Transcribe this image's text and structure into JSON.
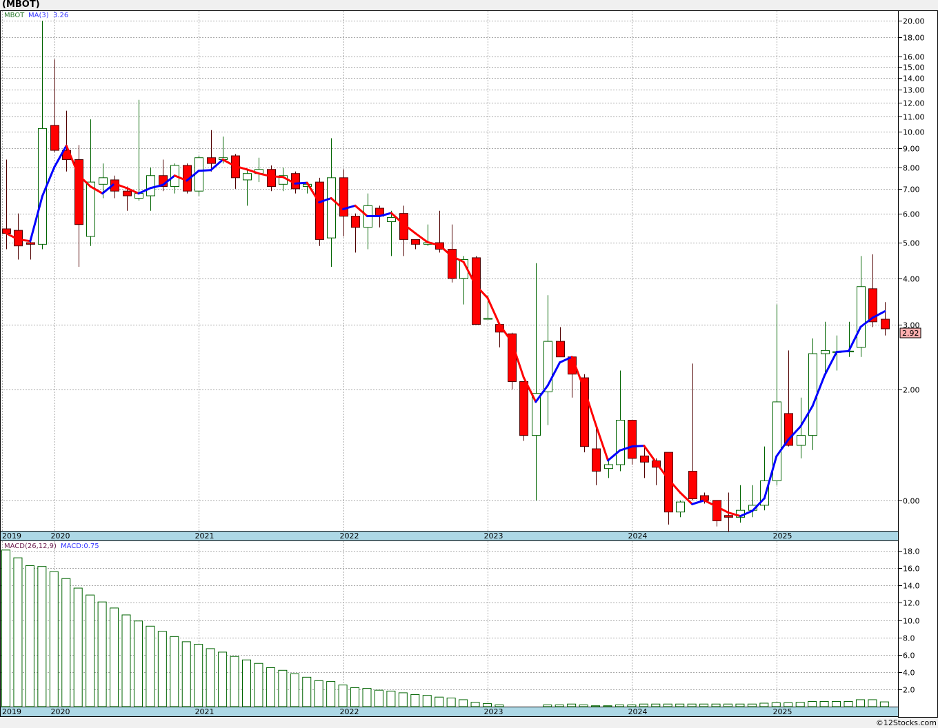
{
  "header": {
    "title": "(MBOT)",
    "copyright": "©12Stocks.com"
  },
  "legend": {
    "symbol": "MBOT",
    "ma_label": "MA(3)",
    "ma_value": "3.26",
    "macd_label": "MACD(26,12,9)",
    "macd_value": "MACD:0.75"
  },
  "colors": {
    "up": "#008000",
    "down": "#ff0000",
    "ma_up": "#0000ff",
    "ma_down": "#ff0000",
    "macd_bar": "#006400",
    "date_band": "#add8e6",
    "last_price_bg": "#ffb0b0"
  },
  "chart_data": [
    {
      "type": "candlestick",
      "interval": "monthly",
      "y_scale": "log",
      "ylim": [
        0.83,
        21
      ],
      "grid": true,
      "last_price": "2.92",
      "y_ticks": [
        {
          "v": 20,
          "label": "20.00"
        },
        {
          "v": 18,
          "label": "18.00"
        },
        {
          "v": 16,
          "label": "16.00"
        },
        {
          "v": 15,
          "label": "15.00"
        },
        {
          "v": 14,
          "label": "14.00"
        },
        {
          "v": 13,
          "label": "13.00"
        },
        {
          "v": 12,
          "label": "12.00"
        },
        {
          "v": 11,
          "label": "11.00"
        },
        {
          "v": 10,
          "label": "10.00"
        },
        {
          "v": 9,
          "label": "9.00"
        },
        {
          "v": 8,
          "label": "8.00"
        },
        {
          "v": 7,
          "label": "7.00"
        },
        {
          "v": 6,
          "label": "6.00"
        },
        {
          "v": 5,
          "label": "5.00"
        },
        {
          "v": 4,
          "label": "4.00"
        },
        {
          "v": 3,
          "label": "3.00"
        },
        {
          "v": 2,
          "label": "2.00"
        },
        {
          "v": 1,
          "label": "0.00"
        }
      ],
      "x_ticks": [
        {
          "index": -0.35,
          "label": "2019"
        },
        {
          "index": 4,
          "label": "2020"
        },
        {
          "index": 16,
          "label": "2021"
        },
        {
          "index": 28,
          "label": "2022"
        },
        {
          "index": 40,
          "label": "2023"
        },
        {
          "index": 52,
          "label": "2024"
        },
        {
          "index": 64,
          "label": "2025"
        }
      ],
      "first_month": "2019-09",
      "ohlc": [
        [
          5.45,
          8.4,
          4.8,
          5.3
        ],
        [
          5.4,
          6.0,
          4.5,
          4.9
        ],
        [
          5.0,
          5.1,
          4.5,
          4.95
        ],
        [
          4.95,
          20.0,
          4.8,
          10.2
        ],
        [
          10.4,
          15.7,
          8.8,
          8.9
        ],
        [
          8.9,
          11.4,
          7.8,
          8.4
        ],
        [
          8.4,
          9.2,
          4.3,
          5.6
        ],
        [
          5.2,
          10.8,
          4.9,
          7.3
        ],
        [
          7.2,
          8.2,
          6.6,
          7.5
        ],
        [
          7.4,
          7.6,
          6.6,
          6.9
        ],
        [
          6.9,
          7.1,
          6.1,
          6.7
        ],
        [
          6.6,
          12.2,
          6.5,
          6.8
        ],
        [
          6.7,
          8.0,
          6.1,
          7.6
        ],
        [
          7.6,
          8.4,
          6.9,
          7.1
        ],
        [
          7.1,
          8.2,
          6.8,
          8.1
        ],
        [
          8.1,
          8.2,
          6.8,
          6.9
        ],
        [
          6.9,
          8.6,
          6.7,
          8.5
        ],
        [
          8.5,
          10.1,
          7.8,
          8.2
        ],
        [
          8.4,
          9.7,
          8.2,
          8.5
        ],
        [
          8.6,
          8.7,
          7.0,
          7.5
        ],
        [
          7.4,
          7.9,
          6.3,
          7.7
        ],
        [
          7.7,
          8.5,
          7.3,
          7.9
        ],
        [
          7.9,
          8.1,
          6.9,
          7.1
        ],
        [
          7.2,
          8.0,
          6.9,
          7.6
        ],
        [
          7.7,
          7.8,
          6.8,
          7.0
        ],
        [
          7.1,
          7.3,
          6.8,
          7.2
        ],
        [
          7.3,
          7.5,
          4.9,
          5.1
        ],
        [
          5.15,
          9.6,
          4.3,
          7.5
        ],
        [
          7.5,
          7.9,
          5.2,
          5.9
        ],
        [
          5.9,
          6.0,
          4.7,
          5.5
        ],
        [
          5.5,
          6.8,
          4.8,
          6.3
        ],
        [
          6.2,
          6.3,
          5.5,
          5.9
        ],
        [
          5.7,
          6.1,
          4.6,
          5.85
        ],
        [
          6.0,
          6.3,
          4.6,
          5.1
        ],
        [
          5.1,
          5.1,
          4.8,
          4.95
        ],
        [
          4.95,
          5.6,
          4.9,
          5.0
        ],
        [
          5.0,
          6.1,
          4.7,
          4.8
        ],
        [
          4.8,
          5.6,
          3.9,
          4.0
        ],
        [
          4.0,
          4.6,
          3.4,
          4.5
        ],
        [
          4.55,
          4.6,
          3.0,
          3.0
        ],
        [
          3.1,
          3.6,
          3.1,
          3.12
        ],
        [
          3.0,
          3.0,
          2.6,
          2.86
        ],
        [
          2.83,
          2.85,
          2.0,
          2.1
        ],
        [
          2.1,
          2.1,
          1.45,
          1.5
        ],
        [
          1.5,
          4.4,
          1.0,
          1.95
        ],
        [
          1.97,
          3.6,
          1.6,
          2.7
        ],
        [
          2.7,
          2.95,
          2.45,
          2.45
        ],
        [
          2.45,
          2.45,
          1.9,
          2.2
        ],
        [
          2.15,
          2.2,
          1.35,
          1.4
        ],
        [
          1.38,
          1.6,
          1.1,
          1.2
        ],
        [
          1.22,
          1.3,
          1.15,
          1.25
        ],
        [
          1.25,
          2.25,
          1.2,
          1.65
        ],
        [
          1.65,
          1.65,
          1.25,
          1.3
        ],
        [
          1.32,
          1.4,
          1.15,
          1.27
        ],
        [
          1.28,
          1.3,
          1.1,
          1.23
        ],
        [
          1.35,
          1.35,
          0.86,
          0.93
        ],
        [
          0.93,
          1.0,
          0.9,
          0.99
        ],
        [
          1.2,
          2.35,
          1.0,
          1.01
        ],
        [
          1.03,
          1.05,
          0.98,
          1.0
        ],
        [
          1.0,
          1.0,
          0.85,
          0.88
        ],
        [
          0.91,
          1.05,
          0.82,
          0.9
        ],
        [
          0.9,
          1.1,
          0.87,
          0.94
        ],
        [
          0.94,
          1.1,
          0.9,
          0.97
        ],
        [
          0.97,
          1.4,
          0.94,
          1.13
        ],
        [
          1.13,
          3.4,
          1.1,
          1.85
        ],
        [
          1.72,
          2.55,
          1.4,
          1.41
        ],
        [
          1.41,
          1.9,
          1.3,
          1.5
        ],
        [
          1.5,
          2.75,
          1.37,
          2.5
        ],
        [
          2.5,
          3.05,
          2.2,
          2.55
        ],
        [
          2.52,
          2.8,
          2.25,
          2.53
        ],
        [
          2.53,
          3.05,
          2.45,
          2.54
        ],
        [
          2.6,
          4.6,
          2.45,
          3.8
        ],
        [
          3.75,
          4.65,
          2.95,
          3.05
        ],
        [
          3.1,
          3.45,
          2.8,
          2.92
        ]
      ]
    },
    {
      "type": "bar",
      "name": "MACD(26,12,9)",
      "ylim": [
        0,
        19
      ],
      "grid": true,
      "y_ticks": [
        {
          "v": 18,
          "label": "18.0"
        },
        {
          "v": 16,
          "label": "16.0"
        },
        {
          "v": 14,
          "label": "14.0"
        },
        {
          "v": 12,
          "label": "12.0"
        },
        {
          "v": 10,
          "label": "10.0"
        },
        {
          "v": 8,
          "label": "8.0"
        },
        {
          "v": 6,
          "label": "6.0"
        },
        {
          "v": 4,
          "label": "4.0"
        },
        {
          "v": 2,
          "label": "2.0"
        }
      ],
      "values": [
        18.1,
        17.2,
        16.3,
        16.2,
        15.6,
        14.8,
        13.7,
        12.9,
        12.1,
        11.4,
        10.6,
        9.9,
        9.3,
        8.7,
        8.1,
        7.5,
        7.2,
        6.7,
        6.3,
        5.8,
        5.4,
        5.0,
        4.5,
        4.2,
        3.8,
        3.4,
        3.0,
        2.9,
        2.5,
        2.2,
        2.1,
        1.9,
        1.8,
        1.6,
        1.4,
        1.3,
        1.1,
        1.0,
        0.8,
        0.5,
        0.35,
        0.2,
        0,
        0,
        0,
        0.2,
        0.2,
        0.3,
        0.2,
        0.1,
        0.1,
        0.2,
        0.2,
        0.3,
        0.3,
        0.3,
        0.3,
        0.3,
        0.3,
        0.3,
        0.3,
        0.3,
        0.3,
        0.4,
        0.45,
        0.45,
        0.5,
        0.6,
        0.6,
        0.6,
        0.6,
        0.8,
        0.8,
        0.55
      ]
    }
  ]
}
